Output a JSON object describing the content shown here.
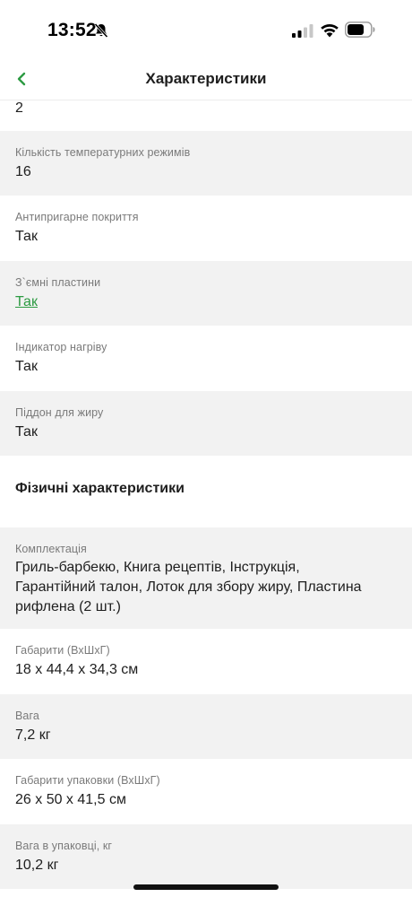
{
  "status_bar": {
    "time": "13:52"
  },
  "nav": {
    "title": "Характеристики"
  },
  "partial_value": "2",
  "rows_top": [
    {
      "label": "Кількість температурних режимів",
      "value": "16"
    },
    {
      "label": "Антипригарне покриття",
      "value": "Так"
    },
    {
      "label": "З`ємні пластини",
      "value": "Так",
      "is_link": true
    },
    {
      "label": "Індикатор нагріву",
      "value": "Так"
    },
    {
      "label": "Піддон для жиру",
      "value": "Так"
    }
  ],
  "section": {
    "title": "Фізичні характеристики"
  },
  "rows_physical": [
    {
      "label": "Комплектація",
      "value_lines": [
        "Гриль-барбекю, Книга рецептів, Інструкція,",
        "Гарантійний талон, Лоток для збору жиру, Пластина",
        "рифлена (2 шт.)"
      ]
    },
    {
      "label": "Габарити (ВхШхГ)",
      "value": "18 x 44,4 x 34,3 см"
    },
    {
      "label": "Вага",
      "value": "7,2 кг"
    },
    {
      "label": "Габарити упаковки (ВхШхГ)",
      "value": "26 x 50 x 41,5 см"
    },
    {
      "label": "Вага в упаковці, кг",
      "value": "10,2 кг"
    }
  ],
  "colors": {
    "accent_green": "#2d9b43",
    "row_gray": "#f2f2f2",
    "label_gray": "#7a7a7a"
  }
}
